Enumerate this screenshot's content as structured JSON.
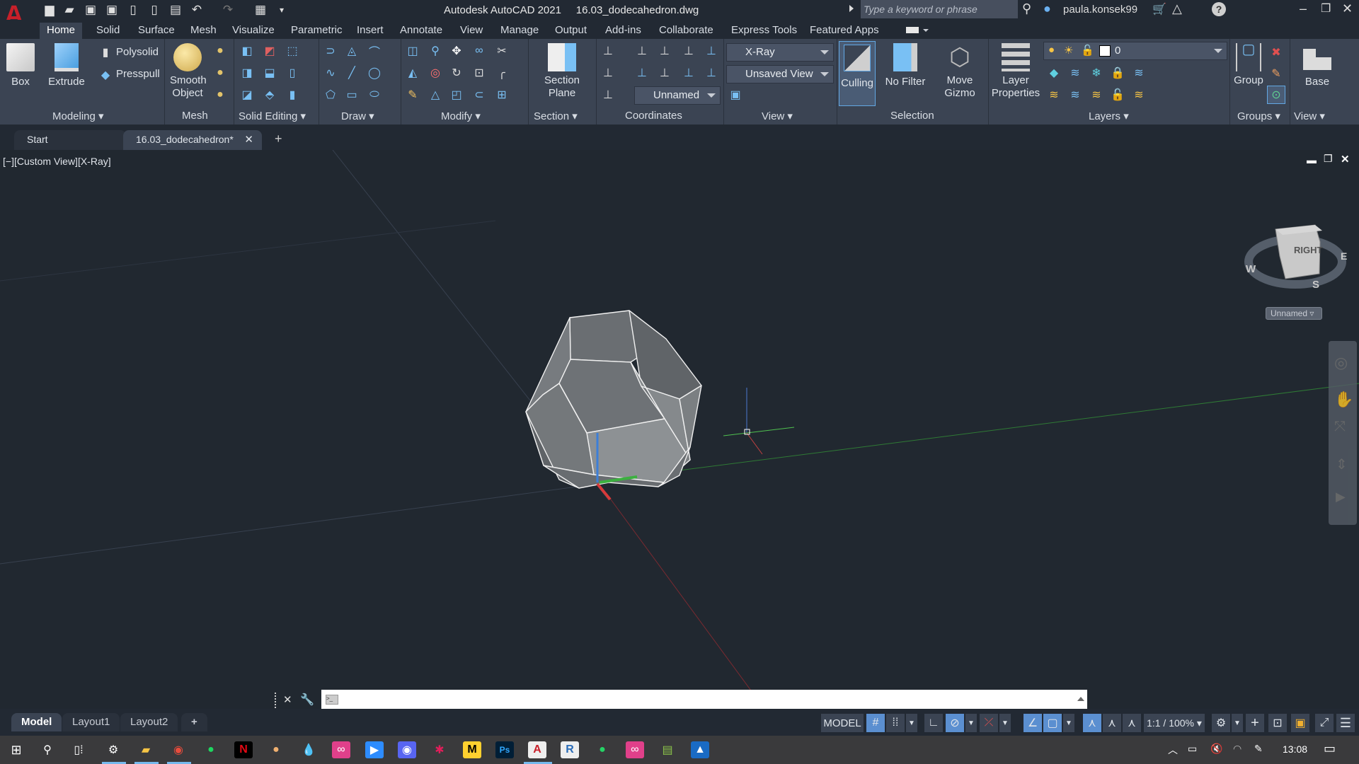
{
  "app": {
    "title": "Autodesk AutoCAD 2021",
    "filename": "16.03_dodecahedron.dwg",
    "logo": "A",
    "search_placeholder": "Type a keyword or phrase",
    "user": "paula.konsek99",
    "quick_access": [
      "new-icon",
      "open-icon",
      "save-icon",
      "save-as-icon",
      "open-from-web-icon",
      "save-to-web-icon",
      "plot-icon",
      "undo-icon",
      "redo-icon",
      "workspace-icon",
      "customize-icon"
    ]
  },
  "ribbon_tabs": [
    "Home",
    "Solid",
    "Surface",
    "Mesh",
    "Visualize",
    "Parametric",
    "Insert",
    "Annotate",
    "View",
    "Manage",
    "Output",
    "Add-ins",
    "Collaborate",
    "Express Tools",
    "Featured Apps"
  ],
  "active_tab": "Home",
  "panels": {
    "modeling": {
      "title": "Modeling",
      "box": "Box",
      "extrude": "Extrude",
      "polysolid": "Polysolid",
      "presspull": "Presspull"
    },
    "mesh": {
      "title": "Mesh",
      "smooth1": "Smooth",
      "smooth2": "Object"
    },
    "solid_editing": {
      "title": "Solid Editing"
    },
    "draw": {
      "title": "Draw"
    },
    "modify": {
      "title": "Modify"
    },
    "section": {
      "title": "Section",
      "btn1": "Section",
      "btn2": "Plane"
    },
    "coordinates": {
      "title": "Coordinates",
      "ucs": "Unnamed"
    },
    "view": {
      "title": "View",
      "visual_style": "X-Ray",
      "named_view": "Unsaved View"
    },
    "selection": {
      "title": "Selection",
      "culling": "Culling",
      "filter": "No Filter",
      "gizmo1": "Move",
      "gizmo2": "Gizmo"
    },
    "layers": {
      "title": "Layers",
      "props1": "Layer",
      "props2": "Properties",
      "current_layer": "0"
    },
    "groups": {
      "title": "Groups",
      "group": "Group"
    },
    "view2": {
      "title": "View",
      "base": "Base"
    }
  },
  "file_tabs": [
    {
      "label": "Start",
      "active": false
    },
    {
      "label": "16.03_dodecahedron*",
      "active": true
    }
  ],
  "viewport": {
    "label": "[−][Custom View][X-Ray]",
    "viewcube_face": "RIGHT",
    "compass": {
      "w": "W",
      "e": "E",
      "s": "S"
    },
    "ucs_name": "Unnamed"
  },
  "command_line": {
    "value": "",
    "placeholder": ""
  },
  "layout_tabs": [
    {
      "label": "Model",
      "active": true
    },
    {
      "label": "Layout1",
      "active": false
    },
    {
      "label": "Layout2",
      "active": false
    }
  ],
  "status_bar": {
    "model": "MODEL",
    "scale": "1:1 / 100%"
  },
  "taskbar": {
    "apps": [
      "windows-start",
      "search",
      "task-view",
      "settings",
      "file-explorer",
      "chrome",
      "spotify",
      "netflix",
      "app-orange",
      "app-drop",
      "creative-cloud",
      "zoom",
      "discord",
      "slack",
      "miro",
      "photoshop",
      "autocad",
      "revit",
      "whatsapp",
      "creative-cloud-2",
      "notepad-app",
      "photos"
    ],
    "time": "13:08"
  }
}
